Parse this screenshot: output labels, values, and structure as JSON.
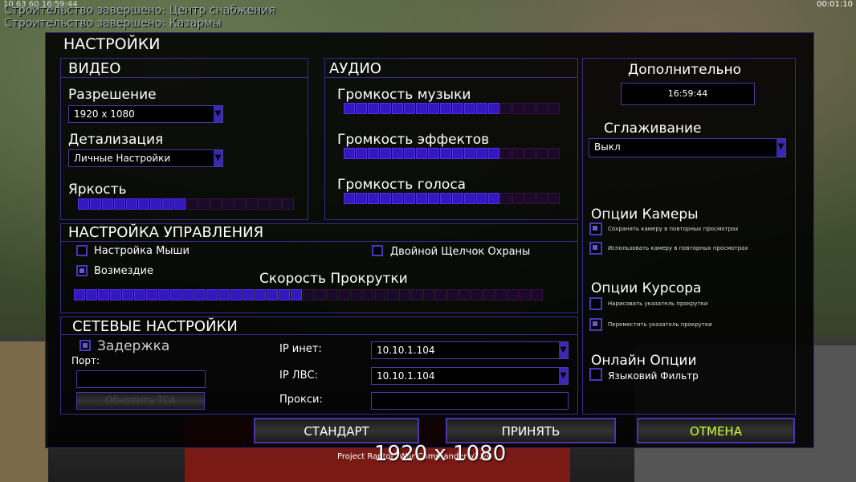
{
  "top": {
    "status_text": "10 63 60 16:59:44",
    "clock": "00:01:10",
    "messages": [
      "Строительство завершено: Центр снабжения",
      "Строительство завершено: Казармы"
    ]
  },
  "dialog": {
    "title": "НАСТРОЙКИ",
    "video": {
      "title": "ВИДЕО",
      "resolution_label": "Разрешение",
      "resolution_value": "1920 x 1080",
      "detail_label": "Детализация",
      "detail_value": "Личные Настройки",
      "brightness_label": "Яркость",
      "brightness_level": 0.5
    },
    "audio": {
      "title": "АУДИО",
      "music_label": "Громкость музыки",
      "music_level": 0.7,
      "effects_label": "Громкость эффектов",
      "effects_level": 0.7,
      "voice_label": "Громкость голоса",
      "voice_level": 0.7
    },
    "controls": {
      "title": "НАСТРОЙКА УПРАВЛЕНИЯ",
      "mouse_label": "Настройка Мыши",
      "mouse_checked": false,
      "retaliation_label": "Возмездие",
      "retaliation_checked": true,
      "double_click_label": "Двойной Щелчок Охраны",
      "double_click_checked": false,
      "scroll_label": "Скорость Прокрутки",
      "scroll_level": 0.48
    },
    "network": {
      "title": "СЕТЕВЫЕ НАСТРОЙКИ",
      "latency_label": "Задержка",
      "latency_checked": true,
      "port_label": "Порт:",
      "port_value": "",
      "update_tca_label": "Обновить TCA",
      "ip_inet_label": "IP инет:",
      "ip_inet_value": "10.10.1.104",
      "ip_lan_label": "IP ЛВС:",
      "ip_lan_value": "10.10.1.104",
      "proxy_label": "Прокси:",
      "proxy_value": ""
    },
    "extra": {
      "title": "Дополнительно",
      "time": "16:59:44",
      "aa_label": "Сглаживание",
      "aa_value": "Выкл",
      "camera_title": "Опции Камеры",
      "camera_opt1": "Сохранять камеру в повторных просмотрах",
      "camera_opt1_checked": true,
      "camera_opt2": "Использовать камеру в повторных просмотрах",
      "camera_opt2_checked": true,
      "cursor_title": "Опции Курсора",
      "cursor_opt1": "Нарисовать указатель прокрутки",
      "cursor_opt1_checked": false,
      "cursor_opt2": "Переместить указатель прокрутки",
      "cursor_opt2_checked": true,
      "online_title": "Онлайн Опции",
      "lang_filter": "Языковий Фильтр",
      "lang_filter_checked": false
    },
    "buttons": {
      "default": "СТАНДАРТ",
      "accept": "ПРИНЯТЬ",
      "cancel": "ОТМЕНА"
    }
  },
  "bottom": {
    "resolution_overlay": "1920 x 1080",
    "footer": "Project Raptor: War Commander v1.20"
  },
  "colors": {
    "accent": "#3318c0",
    "cancel_text": "#c8ff30"
  }
}
